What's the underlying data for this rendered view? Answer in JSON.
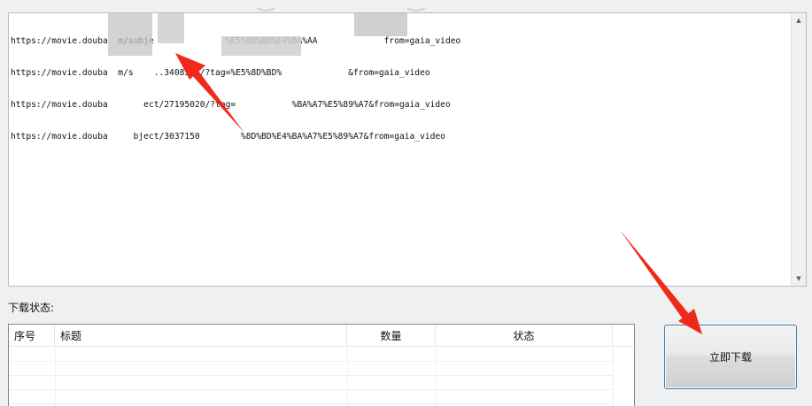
{
  "url_input": {
    "lines": [
      "https://movie.douba  m/subje              %E5%8D%BD%E4%BA%AA             from=gaia_video",
      "https://movie.douba  m/s    ..3408581/?tag=%E5%8D%BD%             &from=gaia_video",
      "https://movie.douba       ect/27195020/?tag=           %BA%A7%E5%89%A7&from=gaia_video",
      "https://movie.douba     bject/3037150        %8D%BD%E4%BA%A7%E5%89%A7&from=gaia_video"
    ]
  },
  "status_section": {
    "label": "下载状态:"
  },
  "table": {
    "columns": [
      "序号",
      "标题",
      "数量",
      "状态"
    ],
    "rows": []
  },
  "download_button": {
    "label": "立即下载"
  },
  "colors": {
    "annotation_arrow": "#f02a1a",
    "button_border": "#3c7fb1",
    "textbox_border": "#a8c0d8"
  },
  "icons": {
    "scroll_up": "scroll-up-arrow-icon",
    "scroll_down": "scroll-down-arrow-icon"
  }
}
